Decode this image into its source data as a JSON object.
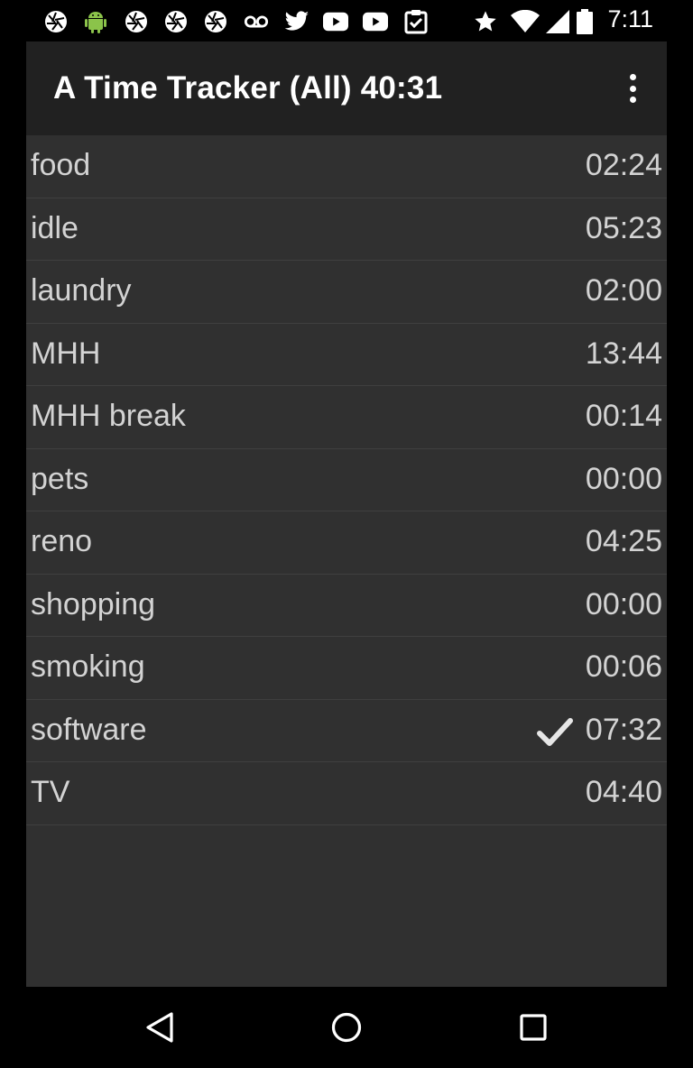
{
  "status_bar": {
    "icons": [
      "aperture-icon",
      "android-icon",
      "aperture-icon",
      "aperture-icon",
      "aperture-icon",
      "voicemail-icon",
      "twitter-icon",
      "youtube-icon",
      "youtube-icon",
      "clipboard-check-icon",
      "star-icon",
      "wifi-icon",
      "signal-icon",
      "battery-icon"
    ],
    "time": "7:11"
  },
  "action_bar": {
    "title": "A Time Tracker (All) 40:31",
    "overflow_icon": "more-vert-icon"
  },
  "tasks": [
    {
      "name": "food",
      "time": "02:24",
      "active": false
    },
    {
      "name": "idle",
      "time": "05:23",
      "active": false
    },
    {
      "name": "laundry",
      "time": "02:00",
      "active": false
    },
    {
      "name": "MHH",
      "time": "13:44",
      "active": false
    },
    {
      "name": "MHH break",
      "time": "00:14",
      "active": false
    },
    {
      "name": "pets",
      "time": "00:00",
      "active": false
    },
    {
      "name": "reno",
      "time": "04:25",
      "active": false
    },
    {
      "name": "shopping",
      "time": "00:00",
      "active": false
    },
    {
      "name": "smoking",
      "time": "00:06",
      "active": false
    },
    {
      "name": "software",
      "time": "07:32",
      "active": true
    },
    {
      "name": "TV",
      "time": "04:40",
      "active": false
    }
  ],
  "nav_bar": {
    "back": "back-icon",
    "home": "home-icon",
    "recents": "recents-icon"
  },
  "colors": {
    "background": "#000000",
    "action_bar": "#212121",
    "list_bg": "#303030",
    "text": "#d3d3d3"
  }
}
